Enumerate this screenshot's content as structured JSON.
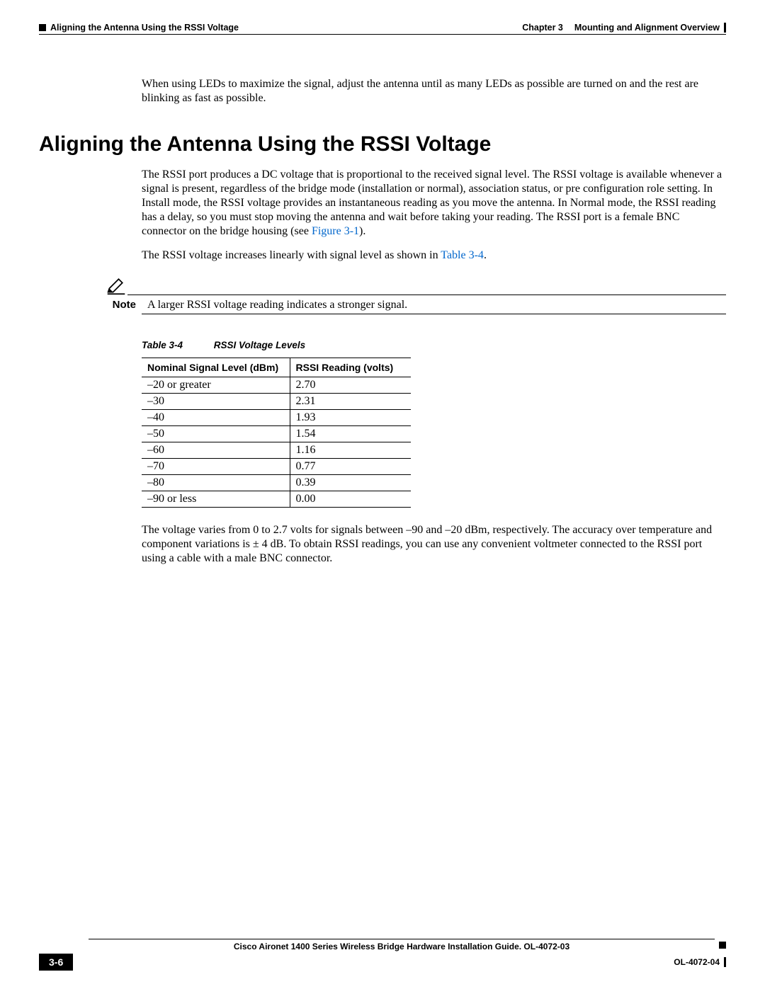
{
  "header": {
    "section_title": "Aligning the Antenna Using the RSSI Voltage",
    "chapter_label": "Chapter 3",
    "chapter_title": "Mounting and Alignment Overview"
  },
  "intro": {
    "led_para": "When using LEDs to maximize the signal, adjust the antenna until as many LEDs as possible are turned on and the rest are blinking as fast as possible."
  },
  "heading": "Aligning the Antenna Using the RSSI Voltage",
  "rssi": {
    "p1a": "The RSSI port produces a DC voltage that is proportional to the received signal level. The RSSI voltage is available whenever a signal is present, regardless of the bridge mode (installation or normal), association status, or pre configuration role setting. In Install mode, the RSSI voltage provides an instantaneous reading as you move the antenna. In Normal mode, the RSSI reading has a delay, so you must stop moving the antenna and wait before taking your reading. The RSSI port is a female BNC connector on the bridge housing (see ",
    "p1_link": "Figure 3-1",
    "p1b": ").",
    "p2a": "The RSSI voltage increases linearly with signal level as shown in ",
    "p2_link": "Table 3-4",
    "p2b": "."
  },
  "note": {
    "label": "Note",
    "text": "A larger RSSI voltage reading indicates a stronger signal."
  },
  "table": {
    "caption_num": "Table 3-4",
    "caption_title": "RSSI Voltage Levels",
    "col1": "Nominal Signal Level (dBm)",
    "col2": "RSSI Reading (volts)",
    "rows": [
      {
        "dbm": "–20 or greater",
        "v": "2.70"
      },
      {
        "dbm": "–30",
        "v": "2.31"
      },
      {
        "dbm": "–40",
        "v": "1.93"
      },
      {
        "dbm": "–50",
        "v": "1.54"
      },
      {
        "dbm": "–60",
        "v": "1.16"
      },
      {
        "dbm": "–70",
        "v": "0.77"
      },
      {
        "dbm": "–80",
        "v": "0.39"
      },
      {
        "dbm": "–90 or less",
        "v": "0.00"
      }
    ]
  },
  "after_table": "The voltage varies from 0 to 2.7 volts for signals between –90 and –20 dBm, respectively. The accuracy over temperature and component variations is ± 4 dB. To obtain RSSI readings, you can use any convenient voltmeter connected to the RSSI port using a cable with a male BNC connector.",
  "footer": {
    "guide_title": "Cisco Aironet 1400 Series Wireless Bridge Hardware Installation Guide. OL-4072-03",
    "page_num": "3-6",
    "doc_id": "OL-4072-04"
  },
  "chart_data": {
    "type": "table",
    "title": "RSSI Voltage Levels",
    "columns": [
      "Nominal Signal Level (dBm)",
      "RSSI Reading (volts)"
    ],
    "rows": [
      [
        "–20 or greater",
        2.7
      ],
      [
        "–30",
        2.31
      ],
      [
        "–40",
        1.93
      ],
      [
        "–50",
        1.54
      ],
      [
        "–60",
        1.16
      ],
      [
        "–70",
        0.77
      ],
      [
        "–80",
        0.39
      ],
      [
        "–90 or less",
        0.0
      ]
    ]
  }
}
